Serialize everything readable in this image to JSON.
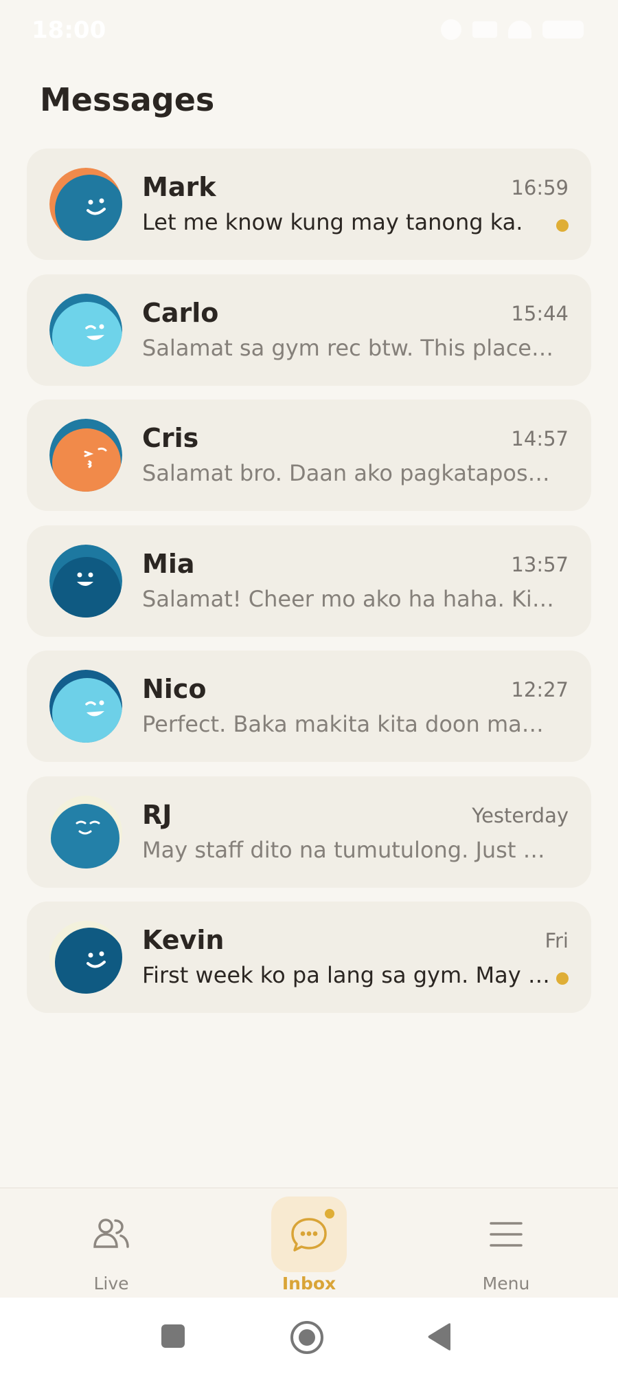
{
  "status_bar": {
    "time": "18:00"
  },
  "header": {
    "title": "Messages"
  },
  "conversations": [
    {
      "name": "Mark",
      "time": "16:59",
      "preview": "Let me know kung may tanong ka.",
      "unread": true,
      "avatar": {
        "back": "#f08a4b",
        "front": "#2079a0",
        "face": "smile"
      }
    },
    {
      "name": "Carlo",
      "time": "15:44",
      "preview": "Salamat sa gym rec btw. This place is solid.",
      "unread": false,
      "avatar": {
        "back": "#1f7aa2",
        "front": "#6ed3ea",
        "face": "wink"
      }
    },
    {
      "name": "Cris",
      "time": "14:57",
      "preview": "Salamat bro. Daan ako pagkatapos ng shift ko.",
      "unread": false,
      "avatar": {
        "back": "#1f7aa2",
        "front": "#f18a4a",
        "face": "kiss"
      }
    },
    {
      "name": "Mia",
      "time": "13:57",
      "preview": "Salamat! Cheer mo ako ha haha. Kita sa gym.",
      "unread": false,
      "avatar": {
        "back": "#1d78a0",
        "front": "#0f5a82",
        "face": "grin"
      }
    },
    {
      "name": "Nico",
      "time": "12:27",
      "preview": "Perfect. Baka makita kita doon mamaya.",
      "unread": false,
      "avatar": {
        "back": "#135f8d",
        "front": "#6dd0e8",
        "face": "wink"
      }
    },
    {
      "name": "RJ",
      "time": "Yesterday",
      "preview": "May staff dito na tumutulong. Just ask them.",
      "unread": false,
      "avatar": {
        "back": "#f3f1dc",
        "front": "#2380a8",
        "face": "calm"
      }
    },
    {
      "name": "Kevin",
      "time": "Fri",
      "preview": "First week ko pa lang sa gym. May best tips ka?",
      "unread": true,
      "avatar": {
        "back": "#f3f1dc",
        "front": "#0f5a82",
        "face": "smile"
      }
    }
  ],
  "bottom_nav": [
    {
      "label": "Live",
      "icon": "people-icon",
      "active": false
    },
    {
      "label": "Inbox",
      "icon": "chat-bubble-icon",
      "active": true,
      "badge": true
    },
    {
      "label": "Menu",
      "icon": "hamburger-menu-icon",
      "active": false
    }
  ],
  "colors": {
    "accent": "#dfae36",
    "card": "#f1eee6",
    "background": "#f8f6f1"
  }
}
